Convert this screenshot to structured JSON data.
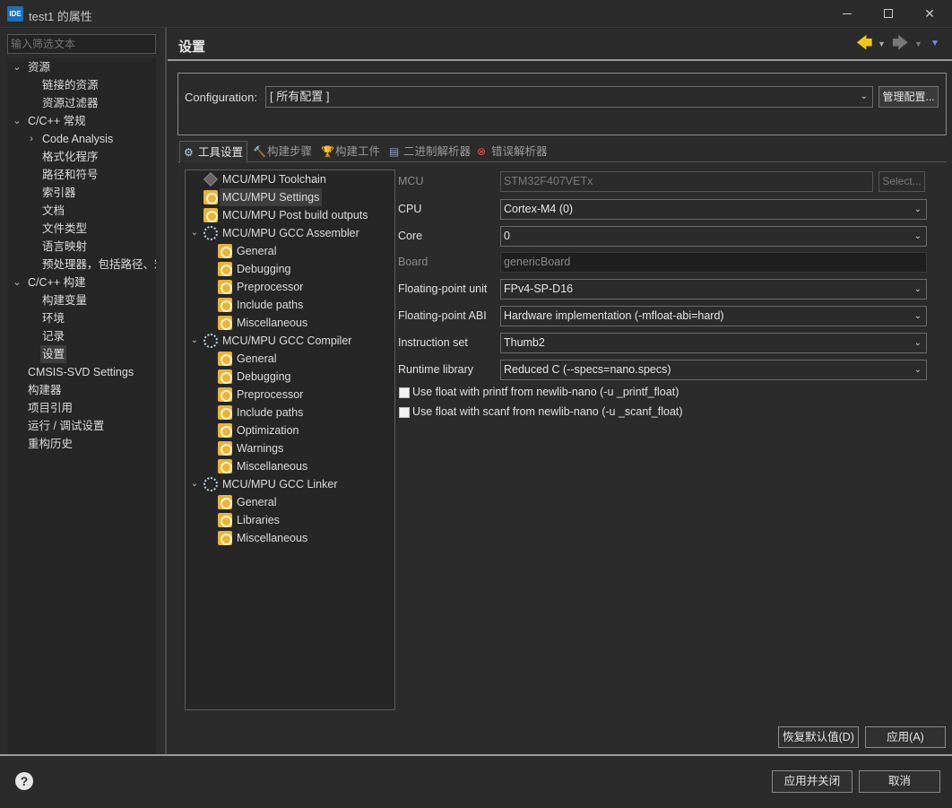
{
  "window": {
    "app_icon_text": "IDE",
    "title": "test1 的属性",
    "minimize": "—",
    "maximize": "☐",
    "close": "✕"
  },
  "nav": {
    "filter_placeholder": "输入筛选文本",
    "items": [
      {
        "label": "资源",
        "expanded": true
      },
      {
        "label": "链接的资源"
      },
      {
        "label": "资源过滤器"
      },
      {
        "label": "C/C++ 常规",
        "expanded": true
      },
      {
        "label": "Code Analysis",
        "expanded": false
      },
      {
        "label": "格式化程序"
      },
      {
        "label": "路径和符号"
      },
      {
        "label": "索引器"
      },
      {
        "label": "文档"
      },
      {
        "label": "文件类型"
      },
      {
        "label": "语言映射"
      },
      {
        "label": "预处理器，包括路径、宏"
      },
      {
        "label": "C/C++ 构建",
        "expanded": true
      },
      {
        "label": "构建变量"
      },
      {
        "label": "环境"
      },
      {
        "label": "记录"
      },
      {
        "label": "设置",
        "selected": true
      },
      {
        "label": "CMSIS-SVD Settings"
      },
      {
        "label": "构建器"
      },
      {
        "label": "项目引用"
      },
      {
        "label": "运行 / 调试设置"
      },
      {
        "label": "重构历史"
      }
    ]
  },
  "panel": {
    "title": "设置",
    "back_icon": "back-arrow-icon",
    "forward_icon": "forward-arrow-icon"
  },
  "config": {
    "label": "Configuration:",
    "value": "[ 所有配置 ]",
    "manage_label": "管理配置..."
  },
  "tabs": [
    {
      "label": "工具设置",
      "active": true
    },
    {
      "label": "构建步骤"
    },
    {
      "label": "构建工件"
    },
    {
      "label": "二进制解析器"
    },
    {
      "label": "错误解析器"
    }
  ],
  "tool_tree": [
    {
      "label": "MCU/MPU Toolchain",
      "level": 1,
      "icon": "chip-icon"
    },
    {
      "label": "MCU/MPU Settings",
      "level": 1,
      "icon": "settings-folder-icon",
      "selected": true
    },
    {
      "label": "MCU/MPU Post build outputs",
      "level": 1,
      "icon": "settings-folder-icon"
    },
    {
      "label": "MCU/MPU GCC Assembler",
      "level": 1,
      "icon": "gear-icon",
      "expanded": true
    },
    {
      "label": "General",
      "level": 2,
      "icon": "settings-folder-icon"
    },
    {
      "label": "Debugging",
      "level": 2,
      "icon": "settings-folder-icon"
    },
    {
      "label": "Preprocessor",
      "level": 2,
      "icon": "settings-folder-icon"
    },
    {
      "label": "Include paths",
      "level": 2,
      "icon": "settings-folder-icon"
    },
    {
      "label": "Miscellaneous",
      "level": 2,
      "icon": "settings-folder-icon"
    },
    {
      "label": "MCU/MPU GCC Compiler",
      "level": 1,
      "icon": "gear-icon",
      "expanded": true
    },
    {
      "label": "General",
      "level": 2,
      "icon": "settings-folder-icon"
    },
    {
      "label": "Debugging",
      "level": 2,
      "icon": "settings-folder-icon"
    },
    {
      "label": "Preprocessor",
      "level": 2,
      "icon": "settings-folder-icon"
    },
    {
      "label": "Include paths",
      "level": 2,
      "icon": "settings-folder-icon"
    },
    {
      "label": "Optimization",
      "level": 2,
      "icon": "settings-folder-icon"
    },
    {
      "label": "Warnings",
      "level": 2,
      "icon": "settings-folder-icon"
    },
    {
      "label": "Miscellaneous",
      "level": 2,
      "icon": "settings-folder-icon"
    },
    {
      "label": "MCU/MPU GCC Linker",
      "level": 1,
      "icon": "gear-icon",
      "expanded": true
    },
    {
      "label": "General",
      "level": 2,
      "icon": "settings-folder-icon"
    },
    {
      "label": "Libraries",
      "level": 2,
      "icon": "settings-folder-icon"
    },
    {
      "label": "Miscellaneous",
      "level": 2,
      "icon": "settings-folder-icon"
    }
  ],
  "form": {
    "mcu": {
      "label": "MCU",
      "value": "STM32F407VETx",
      "select_label": "Select..."
    },
    "cpu": {
      "label": "CPU",
      "value": "Cortex-M4 (0)"
    },
    "core": {
      "label": "Core",
      "value": "0"
    },
    "board": {
      "label": "Board",
      "value": "genericBoard"
    },
    "fpu": {
      "label": "Floating-point unit",
      "value": "FPv4-SP-D16"
    },
    "fabi": {
      "label": "Floating-point ABI",
      "value": "Hardware implementation (-mfloat-abi=hard)"
    },
    "iset": {
      "label": "Instruction set",
      "value": "Thumb2"
    },
    "runtime": {
      "label": "Runtime library",
      "value": "Reduced C (--specs=nano.specs)"
    },
    "printf_float": {
      "label": "Use float with printf from newlib-nano (-u _printf_float)",
      "checked": false
    },
    "scanf_float": {
      "label": "Use float with scanf from newlib-nano (-u _scanf_float)",
      "checked": false
    }
  },
  "buttons": {
    "restore_defaults": "恢复默认值(D)",
    "apply": "应用(A)",
    "apply_close": "应用并关闭",
    "cancel": "取消",
    "help": "?"
  }
}
